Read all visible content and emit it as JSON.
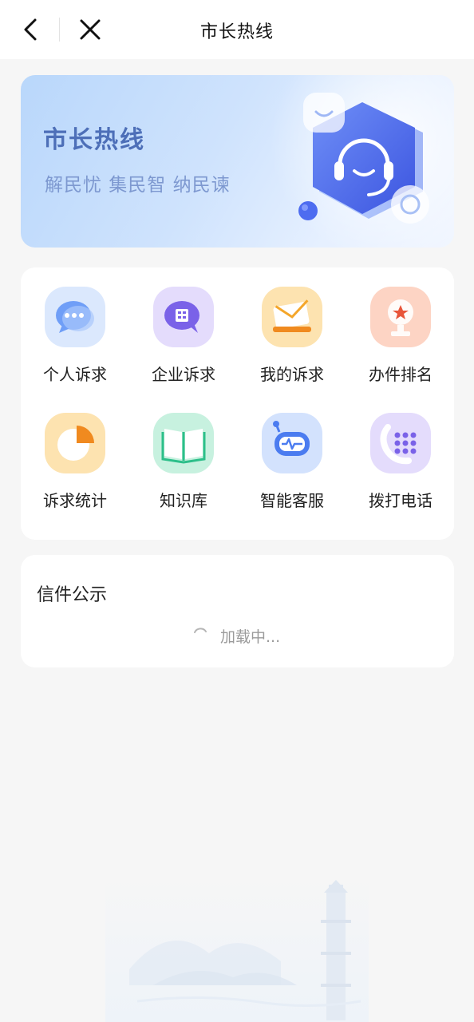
{
  "header": {
    "title": "市长热线",
    "back_icon": "chevron-left-icon",
    "close_icon": "close-icon"
  },
  "banner": {
    "title": "市长热线",
    "slogan": "解民忧 集民智 纳民谏",
    "illustration": "headset-hexagon-icon"
  },
  "services": [
    {
      "label": "个人诉求",
      "icon": "chat-bubble-icon",
      "color": "#5e8ff5"
    },
    {
      "label": "企业诉求",
      "icon": "enterprise-chat-icon",
      "color": "#7a62e8"
    },
    {
      "label": "我的诉求",
      "icon": "envelope-icon",
      "color": "#f4a62a"
    },
    {
      "label": "办件排名",
      "icon": "trophy-icon",
      "color": "#f27c5a"
    },
    {
      "label": "诉求统计",
      "icon": "pie-chart-icon",
      "color": "#f4a62a"
    },
    {
      "label": "知识库",
      "icon": "book-icon",
      "color": "#2dbf8a"
    },
    {
      "label": "智能客服",
      "icon": "robot-icon",
      "color": "#4b7cf0"
    },
    {
      "label": "拨打电话",
      "icon": "phone-keypad-icon",
      "color": "#7a62e8"
    }
  ],
  "letters": {
    "title": "信件公示",
    "loading_text": "加载中..."
  }
}
